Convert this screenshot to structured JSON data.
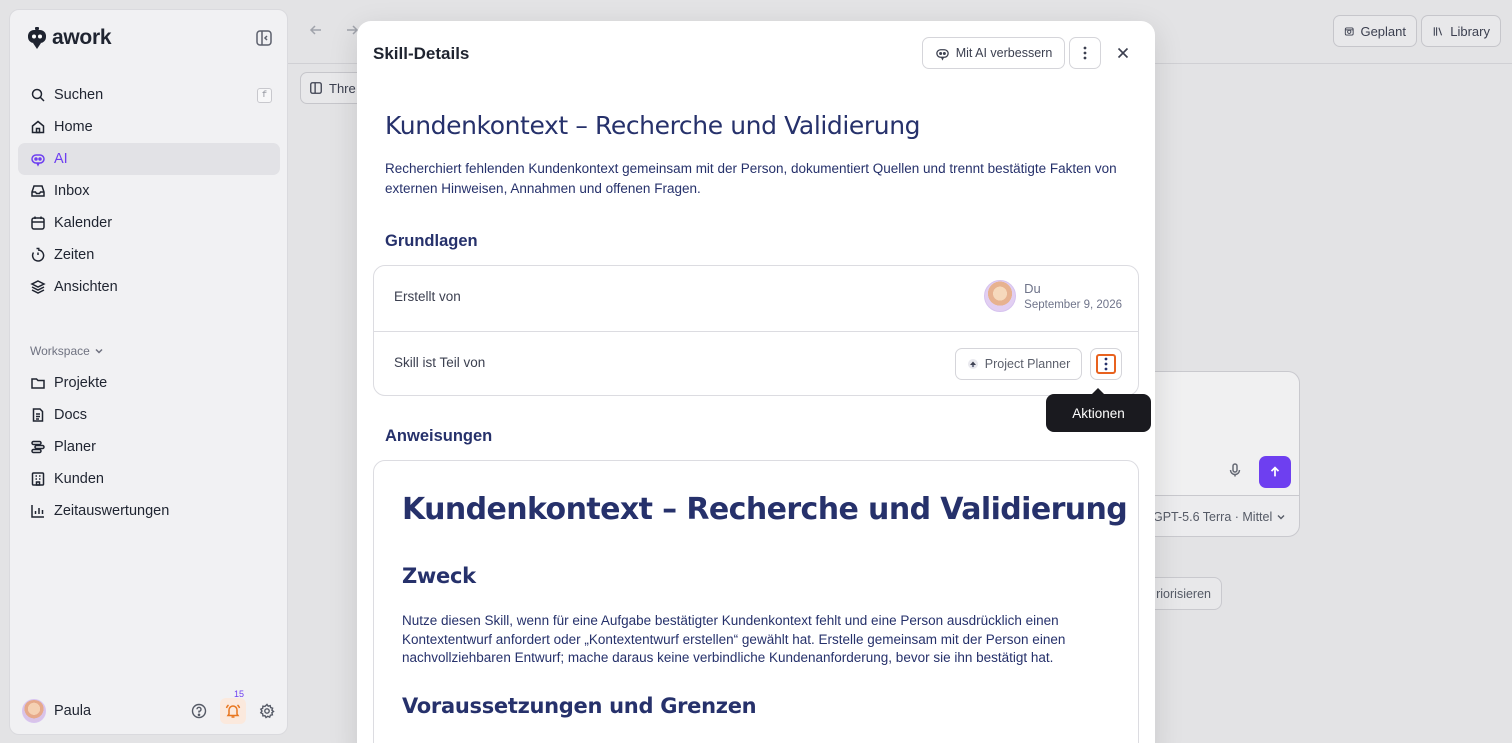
{
  "app": {
    "logo_text": "awork"
  },
  "sidebar": {
    "search": {
      "label": "Suchen",
      "shortcut": "f"
    },
    "items": [
      {
        "label": "Home",
        "icon": "home-icon"
      },
      {
        "label": "AI",
        "icon": "ai-icon",
        "active": true
      },
      {
        "label": "Inbox",
        "icon": "inbox-icon"
      },
      {
        "label": "Kalender",
        "icon": "calendar-icon"
      },
      {
        "label": "Zeiten",
        "icon": "timer-icon"
      },
      {
        "label": "Ansichten",
        "icon": "layers-icon"
      }
    ],
    "workspace_label": "Workspace",
    "workspace_items": [
      {
        "label": "Projekte",
        "icon": "folder-icon"
      },
      {
        "label": "Docs",
        "icon": "doc-icon"
      },
      {
        "label": "Planer",
        "icon": "planner-icon"
      },
      {
        "label": "Kunden",
        "icon": "building-icon"
      },
      {
        "label": "Zeitauswertungen",
        "icon": "chart-icon"
      }
    ],
    "user": {
      "name": "Paula",
      "notification_count": "15"
    }
  },
  "topbar": {
    "geplant_label": "Geplant",
    "library_label": "Library"
  },
  "background": {
    "threads_label": "Thre",
    "model_label": "GPT-5.6 Terra · Mittel",
    "suggestion_label": "riorisieren"
  },
  "modal": {
    "title": "Skill-Details",
    "ai_improve_label": "Mit AI verbessern",
    "skill_title": "Kundenkontext – Recherche und Validierung",
    "skill_description": "Recherchiert fehlenden Kundenkontext gemeinsam mit der Person, dokumentiert Quellen und trennt bestätigte Fakten von externen Hinweisen, Annahmen und offenen Fragen.",
    "grundlagen": {
      "heading": "Grundlagen",
      "created_by_label": "Erstellt von",
      "creator_name": "Du",
      "created_date": "September 9, 2026",
      "part_of_label": "Skill ist Teil von",
      "part_of_value": "Project Planner"
    },
    "anweisungen": {
      "heading": "Anweisungen",
      "h1": "Kundenkontext – Recherche und Validierung",
      "zweck_heading": "Zweck",
      "zweck_text": "Nutze diesen Skill, wenn für eine Aufgabe bestätigter Kundenkontext fehlt und eine Person ausdrücklich einen Kontextentwurf anfordert oder „Kontextentwurf erstellen“ gewählt hat. Erstelle gemeinsam mit der Person einen nachvollziehbaren Entwurf; mache daraus keine verbindliche Kundenanforderung, bevor sie ihn bestätigt hat.",
      "voraussetzungen_heading": "Voraussetzungen und Grenzen"
    }
  },
  "tooltip": {
    "text": "Aktionen"
  },
  "colors": {
    "accent": "#6e3ff0",
    "heading": "#26316b",
    "focus": "#e8621f"
  }
}
